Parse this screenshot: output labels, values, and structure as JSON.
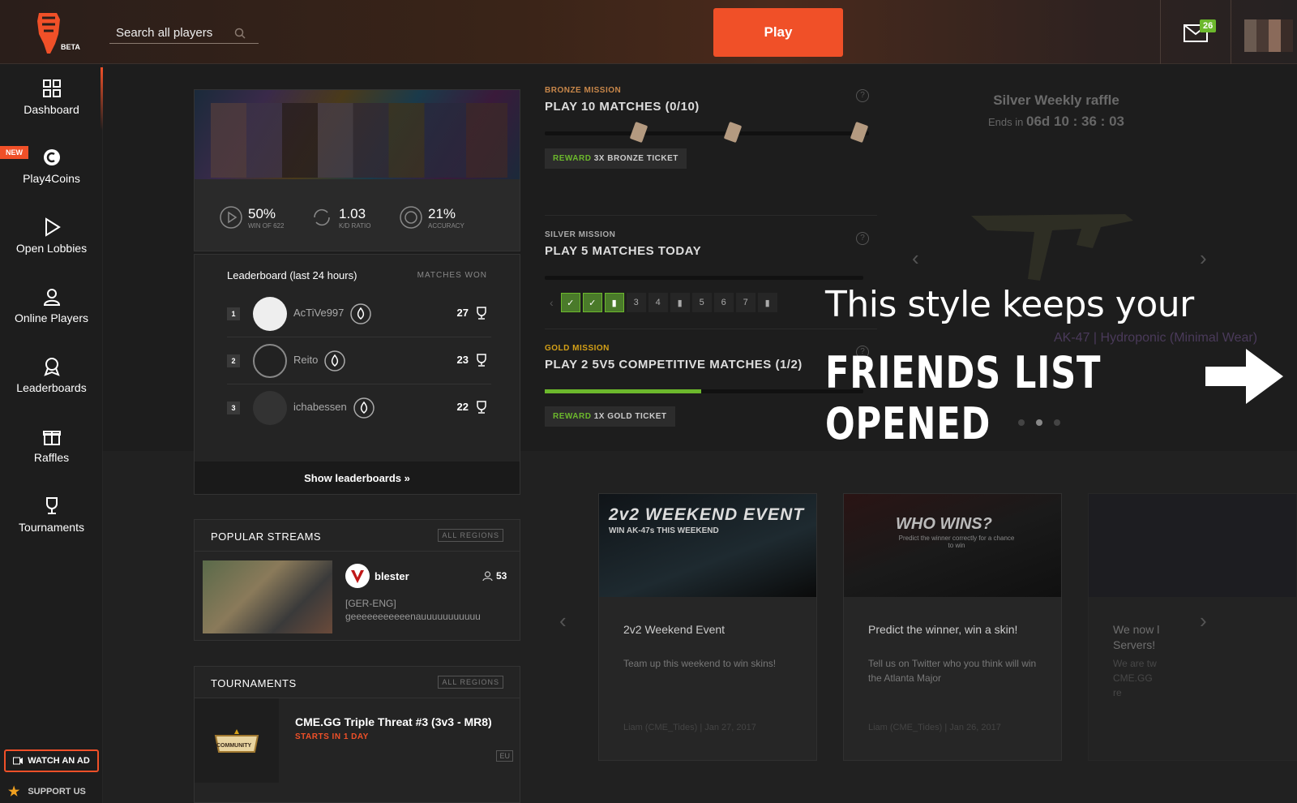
{
  "header": {
    "beta": "BETA",
    "search_placeholder": "Search all players",
    "play_label": "Play",
    "mail_count": "26"
  },
  "sidebar": {
    "new_tag": "NEW",
    "items": [
      {
        "label": "Dashboard"
      },
      {
        "label": "Play4Coins"
      },
      {
        "label": "Open Lobbies"
      },
      {
        "label": "Online Players"
      },
      {
        "label": "Leaderboards"
      },
      {
        "label": "Raffles"
      },
      {
        "label": "Tournaments"
      }
    ],
    "watch_ad": "WATCH AN AD",
    "support": "SUPPORT US"
  },
  "profile": {
    "stats": [
      {
        "value": "50%",
        "label": "WIN OF 622"
      },
      {
        "value": "1.03",
        "label": "K/D RATIO"
      },
      {
        "value": "21%",
        "label": "ACCURACY"
      }
    ]
  },
  "leaderboard": {
    "title": "Leaderboard (last 24 hours)",
    "subtitle": "MATCHES WON",
    "rows": [
      {
        "rank": "1",
        "name": "AcTiVe997",
        "score": "27"
      },
      {
        "rank": "2",
        "name": "Reito",
        "score": "23"
      },
      {
        "rank": "3",
        "name": "ichabessen",
        "score": "22"
      }
    ],
    "footer": "Show leaderboards »"
  },
  "streams": {
    "title": "POPULAR STREAMS",
    "tag": "ALL REGIONS",
    "item": {
      "name": "blester",
      "viewers": "53",
      "line1": "[GER-ENG]",
      "line2": "geeeeeeeeeeenauuuuuuuuuuu"
    }
  },
  "tournaments": {
    "title": "TOURNAMENTS",
    "tag": "ALL REGIONS",
    "item": {
      "name": "CME.GG Triple Threat #3 (3v3 - MR8)",
      "starts": "STARTS IN 1 DAY",
      "region": "EU",
      "logo_text": "COMMUNITY"
    }
  },
  "missions": [
    {
      "tier": "BRONZE MISSION",
      "title": "PLAY 10 MATCHES (0/10)",
      "reward_label": "REWARD",
      "reward": "3X BRONZE TICKET",
      "progress": 0,
      "color": "#c8874a"
    },
    {
      "tier": "SILVER MISSION",
      "title": "PLAY 5 MATCHES TODAY",
      "steps": [
        "3",
        "4",
        "5",
        "6",
        "7"
      ],
      "color": "#aaaaaa"
    },
    {
      "tier": "GOLD MISSION",
      "title": "PLAY 2 5V5 COMPETITIVE MATCHES (1/2)",
      "reward_label": "REWARD",
      "reward": "1X GOLD TICKET",
      "progress": 0.5,
      "color": "#d4a017"
    }
  ],
  "raffle": {
    "title": "Silver Weekly raffle",
    "ends_label": "Ends in",
    "countdown": "06d 10 : 36 : 03",
    "item": "AK-47 | Hydroponic (Minimal Wear)"
  },
  "overlay": {
    "line1": "This style keeps your",
    "line2": "FRIENDS LIST OPENED"
  },
  "events": [
    {
      "img_title": "2v2 WEEKEND EVENT",
      "img_sub": "WIN AK-47s THIS WEEKEND",
      "title": "2v2 Weekend Event",
      "desc": "Team up this weekend to win skins!",
      "meta": "Liam (CME_Tides) | Jan 27, 2017"
    },
    {
      "img_title": "WHO WINS?",
      "img_sub": "Predict the winner correctly for a chance to win",
      "title": "Predict the winner, win a skin!",
      "desc": "Tell us on Twitter who you think will win the Atlanta Major",
      "meta": "Liam (CME_Tides) | Jan 26, 2017"
    },
    {
      "title": "We now l Servers!",
      "desc": "We are tw CME.GG re"
    }
  ],
  "colors": {
    "accent": "#f05028",
    "green": "#6cb82c"
  }
}
